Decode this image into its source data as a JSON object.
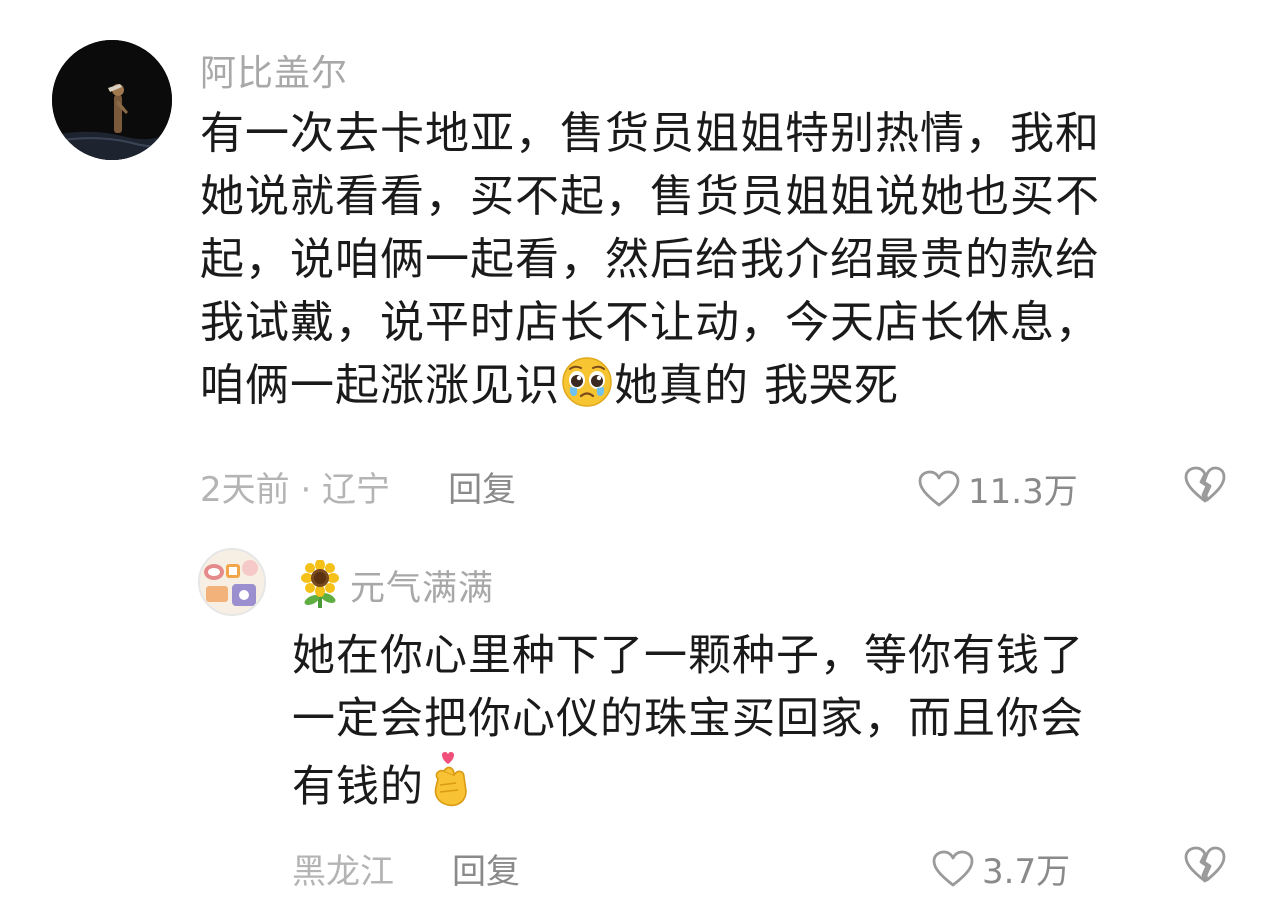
{
  "comment": {
    "username": "阿比盖尔",
    "text_lines": [
      "有一次去卡地亚，售货员姐姐特别热情，我和",
      "她说就看看，买不起，售货员姐姐说她也买不",
      "起，说咱俩一起看，然后给我介绍最贵的款给",
      "我试戴，说平时店长不让动，今天店长休息，"
    ],
    "last_line_before_emoji": "咱俩一起涨涨见识",
    "last_line_after_emoji": "她真的 我哭死",
    "emoji": "pleading-face-icon",
    "time_location": "2天前 · 辽宁",
    "reply_label": "回复",
    "like_count": "11.3万"
  },
  "reply": {
    "username": "元气满满",
    "badge": "sunflower-icon",
    "text_lines": [
      "她在你心里种下了一颗种子，等你有钱了",
      "一定会把你心仪的珠宝买回家，而且你会"
    ],
    "last_line_before_emoji": "有钱的",
    "emoji": "finger-heart-icon",
    "location": "黑龙江",
    "reply_label": "回复",
    "like_count": "3.7万"
  },
  "colors": {
    "text": "#1a1a1a",
    "meta": "#b4b4b4",
    "secondary": "#8a8a8a"
  }
}
